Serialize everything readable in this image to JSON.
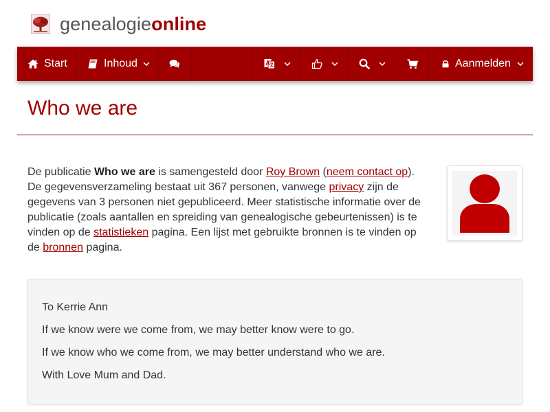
{
  "logo": {
    "light": "genealogie",
    "bold": "online"
  },
  "nav": {
    "start_label": "Start",
    "inhoud_label": "Inhoud",
    "login_label": "Aanmelden"
  },
  "page": {
    "title": "Who we are"
  },
  "intro": {
    "t1": "De publicatie ",
    "pub_title": "Who we are",
    "t2": " is samengesteld door ",
    "author": "Roy Brown",
    "t3": " (",
    "contact": "neem contact op",
    "t4": "). De gegevensverzameling bestaat uit 367 personen, vanwege ",
    "privacy": "privacy",
    "t5": " zijn de gegevens van 3 personen niet gepubliceerd. Meer statistische informatie over de publicatie (zoals aantallen en spreiding van genealogische gebeurtenissen) is te vinden op de ",
    "stats": "statistieken",
    "t6": " pagina. Een lijst met gebruikte bronnen is te vinden op de ",
    "sources": "bronnen",
    "t7": " pagina."
  },
  "message": {
    "lines": [
      "To Kerrie Ann",
      "If we know were we come from, we may better know were to go.",
      "If we know who we come from, we may better understand who we are.",
      "With Love Mum and Dad."
    ]
  },
  "icons": {
    "logo": "tree-icon",
    "home": "home-icon",
    "book": "book-icon",
    "comments": "comments-icon",
    "language": "language-icon",
    "thumbs": "thumbs-up-icon",
    "search": "search-icon",
    "cart": "cart-icon",
    "lock": "lock-icon",
    "avatar": "user-icon"
  },
  "colors": {
    "brand": "#a00000",
    "navbar": "#a00000",
    "text": "#333333",
    "logo_gray": "#555555",
    "well_bg": "#f5f5f5"
  }
}
